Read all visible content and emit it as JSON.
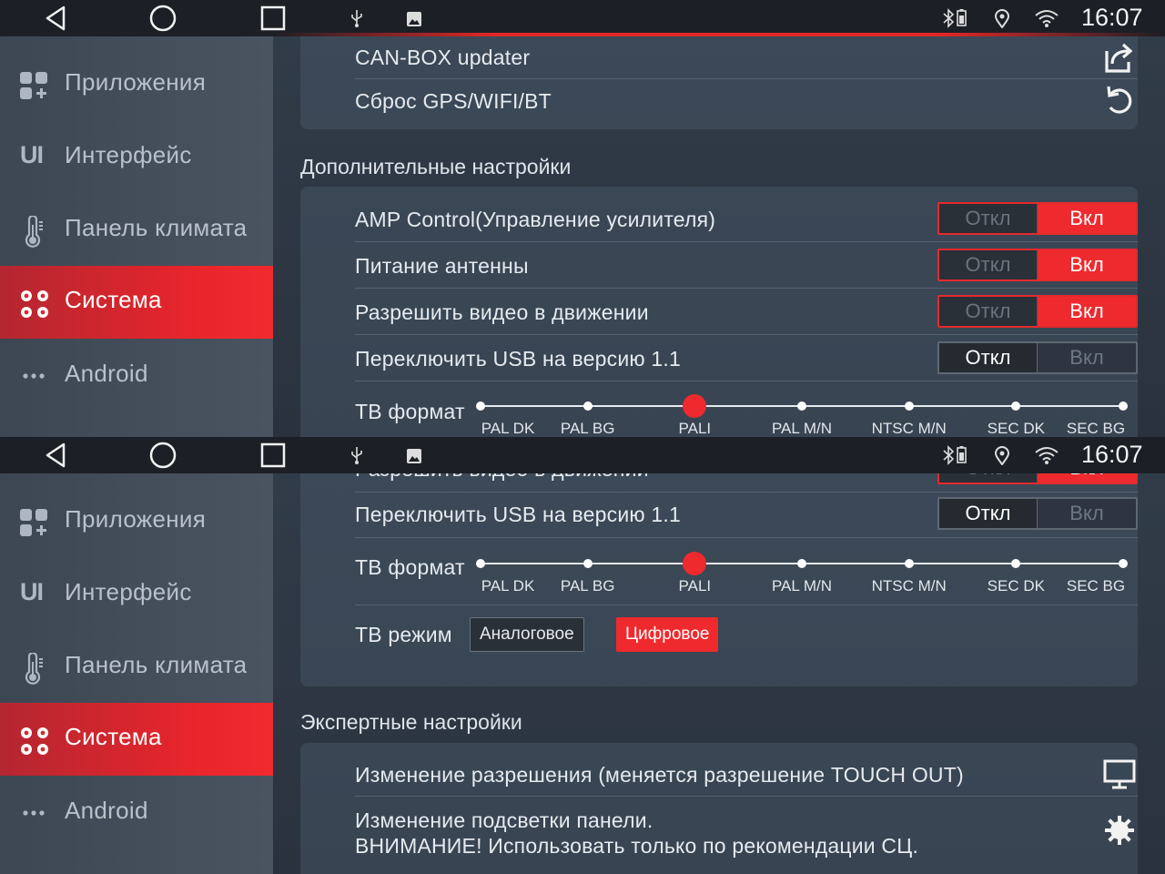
{
  "status": {
    "time": "16:07"
  },
  "sidebar": {
    "items": [
      {
        "label": "Приложения",
        "icon": "apps-grid-icon"
      },
      {
        "label": "Интерфейс",
        "icon_text": "UI"
      },
      {
        "label": "Панель климата",
        "icon": "thermometer-icon"
      },
      {
        "label": "Система",
        "icon": "gears-icon",
        "active": true
      },
      {
        "label": "Android",
        "icon": "more-dots-icon"
      }
    ]
  },
  "top": {
    "items": [
      {
        "label": "CAN-BOX updater",
        "icon": "share-export-icon"
      },
      {
        "label": "Сброс GPS/WIFI/BT",
        "icon": "reset-icon"
      }
    ],
    "section_title": "Дополнительные настройки",
    "toggles": [
      {
        "label": "AMP Control(Управление усилителя)",
        "off": "Откл",
        "on": "Вкл",
        "value": "on"
      },
      {
        "label": "Питание антенны",
        "off": "Откл",
        "on": "Вкл",
        "value": "on"
      },
      {
        "label": "Разрешить видео в движении",
        "off": "Откл",
        "on": "Вкл",
        "value": "on"
      },
      {
        "label": "Переключить USB на версию 1.1",
        "off": "Откл",
        "on": "Вкл",
        "value": "off"
      }
    ],
    "tv_format": {
      "label": "ТВ формат",
      "options": [
        "PAL DK",
        "PAL BG",
        "PALI",
        "PAL M/N",
        "NTSC M/N",
        "SEC DK",
        "SEC BG"
      ],
      "selected": "PALI"
    }
  },
  "bottom": {
    "partial_label": "Разрешить видео в движении",
    "toggle_partial": {
      "off": "Откл",
      "on": "Вкл"
    },
    "usb": {
      "label": "Переключить USB на версию 1.1",
      "off": "Откл",
      "on": "Вкл",
      "value": "off"
    },
    "tv_format": {
      "label": "ТВ формат",
      "options": [
        "PAL DK",
        "PAL BG",
        "PALI",
        "PAL M/N",
        "NTSC M/N",
        "SEC DK",
        "SEC BG"
      ],
      "selected": "PALI"
    },
    "tv_mode": {
      "label": "ТВ режим",
      "analog": "Аналоговое",
      "digital": "Цифровое",
      "selected": "Цифровое"
    },
    "expert_title": "Экспертные настройки",
    "expert_items": [
      {
        "label": "Изменение разрешения (меняется разрешение TOUCH OUT)",
        "icon": "monitor-icon"
      },
      {
        "line1": "Изменение подсветки панели.",
        "line2": "ВНИМАНИЕ! Использовать только по рекомендации СЦ.",
        "icon": "gear-icon"
      }
    ]
  },
  "colors": {
    "accent": "#ef2a2e",
    "statusbar": "#1c2026",
    "sidebar": "#434d59",
    "background": "#2f3844"
  }
}
